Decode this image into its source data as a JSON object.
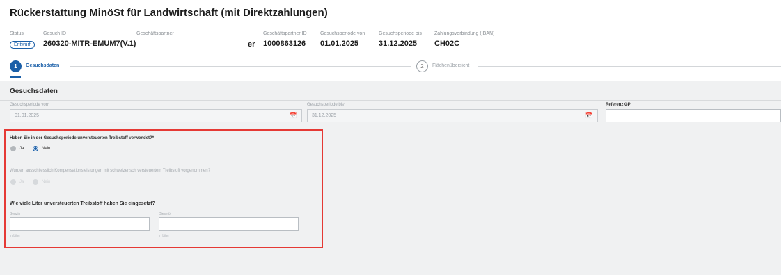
{
  "title": "Rückerstattung MinöSt für Landwirtschaft (mit Direktzahlungen)",
  "header": {
    "status_label": "Status",
    "status_value": "Entwurf",
    "gesuch_id_label": "Gesuch ID",
    "gesuch_id_value": "260320-MITR-EMUM7(V.1)",
    "partner_label": "Geschäftspartner",
    "partner_value_fragment": "er",
    "partner_id_label": "Geschäftspartner ID",
    "partner_id_value": "1000863126",
    "period_from_label": "Gesuchsperiode von",
    "period_from_value": "01.01.2025",
    "period_to_label": "Gesuchsperiode bis",
    "period_to_value": "31.12.2025",
    "iban_label": "Zahlungsverbindung (IBAN)",
    "iban_value": "CH02C"
  },
  "stepper": {
    "steps": [
      {
        "number": "1",
        "label": "Gesuchsdaten",
        "active": true
      },
      {
        "number": "2",
        "label": "Flächenübersicht",
        "active": false
      }
    ]
  },
  "section": {
    "title": "Gesuchsdaten",
    "period_from_label": "Gesuchsperiode von*",
    "period_from_value": "01.01.2025",
    "period_to_label": "Gesuchsperiode bis*",
    "period_to_value": "31.12.2025",
    "referenz_label": "Referenz GP",
    "referenz_value": ""
  },
  "questions": {
    "q1": "Haben Sie in der Gesuchsperiode unversteuerten Treibstoff verwendet?*",
    "q1_options": [
      "Ja",
      "Nein"
    ],
    "q1_selected": "Nein",
    "q2": "Wurden ausschliesslich Kompensationsleistungen mit schweizerisch versteuertem Treibstoff vorgenommen?",
    "q2_options": [
      "Ja",
      "Nein"
    ],
    "q3": "Wie viele Liter unversteuerten Treibstoff haben Sie eingesetzt?",
    "benzin_label": "Benzin",
    "benzin_hint": "in Liter",
    "diesel_label": "Dieselöl",
    "diesel_hint": "in Liter"
  },
  "icons": {
    "calendar": "calendar-icon"
  },
  "colors": {
    "accent": "#1a5fa8",
    "highlight": "#e53935"
  }
}
